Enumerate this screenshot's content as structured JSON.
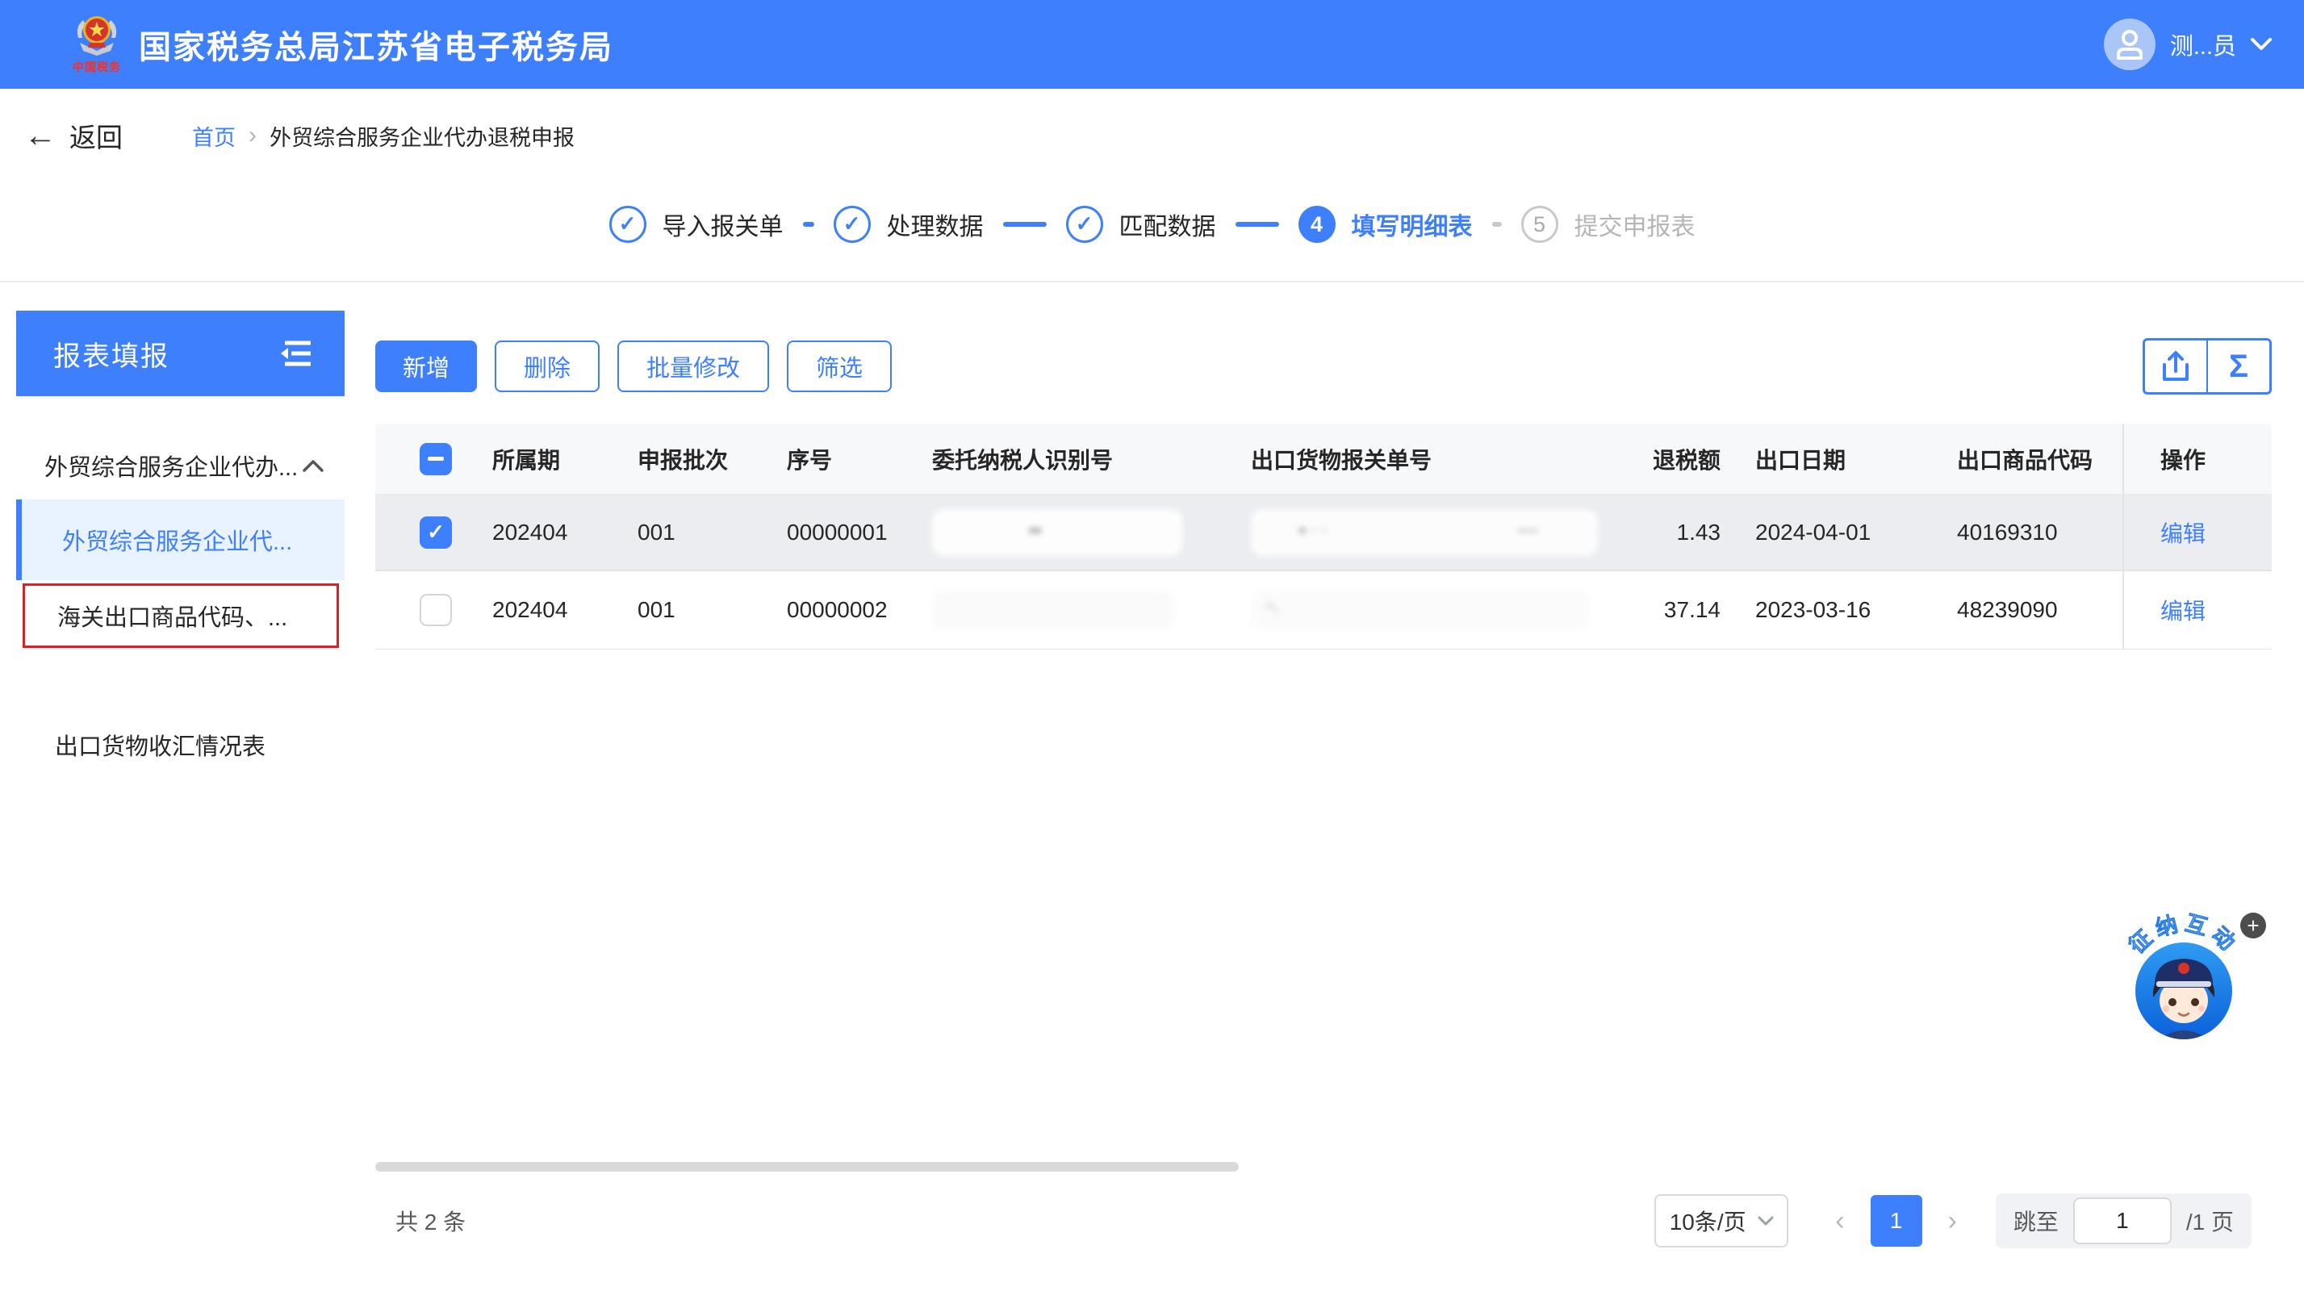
{
  "topbar": {
    "title": "国家税务总局江苏省电子税务局",
    "logo_caption": "中国税务",
    "user_name": "测...员"
  },
  "breadcrumb": {
    "back_label": "返回",
    "home": "首页",
    "separator": "›",
    "current": "外贸综合服务企业代办退税申报"
  },
  "steps": {
    "items": [
      {
        "label": "导入报关单",
        "state": "done"
      },
      {
        "label": "处理数据",
        "state": "done"
      },
      {
        "label": "匹配数据",
        "state": "done"
      },
      {
        "label": "填写明细表",
        "state": "current",
        "number": "4"
      },
      {
        "label": "提交申报表",
        "state": "pending",
        "number": "5"
      }
    ]
  },
  "sidebar": {
    "title": "报表填报",
    "group_label": "外贸综合服务企业代办...",
    "items": [
      {
        "label": "外贸综合服务企业代...",
        "state": "active"
      },
      {
        "label": "海关出口商品代码、...",
        "state": "red-highlighted"
      },
      {
        "label": "出口货物收汇情况表",
        "state": "normal"
      }
    ]
  },
  "toolbar": {
    "add_label": "新增",
    "delete_label": "删除",
    "batch_edit_label": "批量修改",
    "filter_label": "筛选",
    "sigma_glyph": "Σ"
  },
  "table": {
    "columns": {
      "period": "所属期",
      "batch": "申报批次",
      "seq": "序号",
      "taxpayer_id": "委托纳税人识别号",
      "customs_no": "出口货物报关单号",
      "refund": "退税额",
      "export_date": "出口日期",
      "commodity_code": "出口商品代码",
      "action": "操作"
    },
    "rows": [
      {
        "checked": true,
        "period": "202404",
        "batch": "001",
        "seq": "00000001",
        "taxpayer_id": "",
        "customs_no": "",
        "redacted": true,
        "refund": "1.43",
        "export_date": "2024-04-01",
        "commodity_code": "40169310",
        "action": "编辑"
      },
      {
        "checked": false,
        "period": "202404",
        "batch": "001",
        "seq": "00000002",
        "taxpayer_id": "",
        "customs_no": "",
        "redacted": true,
        "refund": "37.14",
        "export_date": "2023-03-16",
        "commodity_code": "48239090",
        "action": "编辑"
      }
    ]
  },
  "footer": {
    "total": "共 2 条",
    "page_size": "10条/页",
    "page": "1",
    "jump_label": "跳至",
    "jump_value": "1",
    "page_suffix": "/1 页"
  },
  "assistant": {
    "label": "征纳互动",
    "plus": "+"
  },
  "colors": {
    "primary": "#3D7FFD",
    "active_item_bg": "#E9F2FF",
    "selected_row_bg": "#EBEDF0",
    "table_header_bg": "#F7F8FA",
    "red_box": "#E02020",
    "pending_gray": "#C9C9C9"
  }
}
